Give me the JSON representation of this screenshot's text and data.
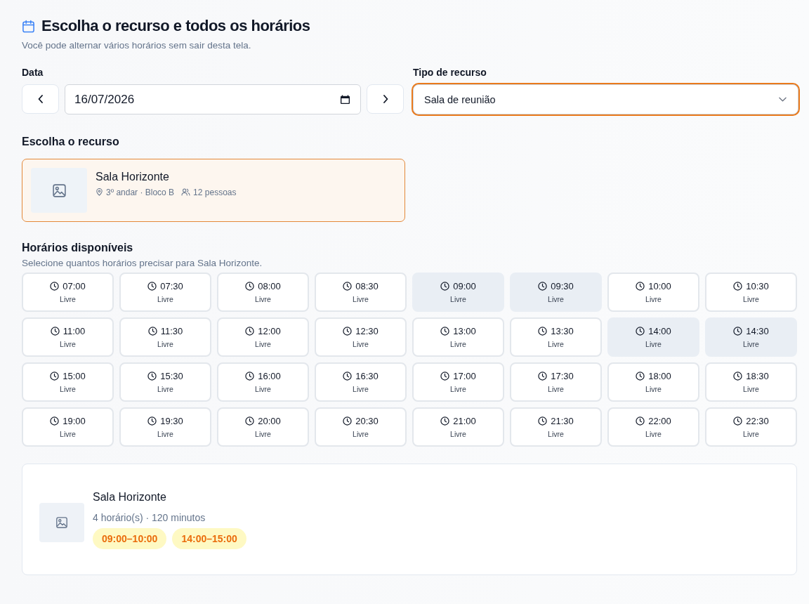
{
  "header": {
    "title": "Escolha o recurso e todos os horários",
    "subtitle": "Você pode alternar vários horários sem sair desta tela."
  },
  "date": {
    "label": "Data",
    "value": "16/07/2026"
  },
  "resource_type": {
    "label": "Tipo de recurso",
    "value": "Sala de reunião",
    "focused": true
  },
  "resources": {
    "title": "Escolha o recurso",
    "items": [
      {
        "name": "Sala Horizonte",
        "location": "3º andar · Bloco B",
        "capacity": "12 pessoas",
        "selected": true
      }
    ]
  },
  "slots": {
    "title": "Horários disponíveis",
    "subtitle": "Selecione quantos horários precisar para Sala Horizonte.",
    "items": [
      {
        "time": "07:00",
        "status": "Livre",
        "selected": false
      },
      {
        "time": "07:30",
        "status": "Livre",
        "selected": false
      },
      {
        "time": "08:00",
        "status": "Livre",
        "selected": false
      },
      {
        "time": "08:30",
        "status": "Livre",
        "selected": false
      },
      {
        "time": "09:00",
        "status": "Livre",
        "selected": true
      },
      {
        "time": "09:30",
        "status": "Livre",
        "selected": true
      },
      {
        "time": "10:00",
        "status": "Livre",
        "selected": false
      },
      {
        "time": "10:30",
        "status": "Livre",
        "selected": false
      },
      {
        "time": "11:00",
        "status": "Livre",
        "selected": false
      },
      {
        "time": "11:30",
        "status": "Livre",
        "selected": false
      },
      {
        "time": "12:00",
        "status": "Livre",
        "selected": false
      },
      {
        "time": "12:30",
        "status": "Livre",
        "selected": false
      },
      {
        "time": "13:00",
        "status": "Livre",
        "selected": false
      },
      {
        "time": "13:30",
        "status": "Livre",
        "selected": false
      },
      {
        "time": "14:00",
        "status": "Livre",
        "selected": true
      },
      {
        "time": "14:30",
        "status": "Livre",
        "selected": true
      },
      {
        "time": "15:00",
        "status": "Livre",
        "selected": false
      },
      {
        "time": "15:30",
        "status": "Livre",
        "selected": false
      },
      {
        "time": "16:00",
        "status": "Livre",
        "selected": false
      },
      {
        "time": "16:30",
        "status": "Livre",
        "selected": false
      },
      {
        "time": "17:00",
        "status": "Livre",
        "selected": false
      },
      {
        "time": "17:30",
        "status": "Livre",
        "selected": false
      },
      {
        "time": "18:00",
        "status": "Livre",
        "selected": false
      },
      {
        "time": "18:30",
        "status": "Livre",
        "selected": false
      },
      {
        "time": "19:00",
        "status": "Livre",
        "selected": false
      },
      {
        "time": "19:30",
        "status": "Livre",
        "selected": false
      },
      {
        "time": "20:00",
        "status": "Livre",
        "selected": false
      },
      {
        "time": "20:30",
        "status": "Livre",
        "selected": false
      },
      {
        "time": "21:00",
        "status": "Livre",
        "selected": false
      },
      {
        "time": "21:30",
        "status": "Livre",
        "selected": false
      },
      {
        "time": "22:00",
        "status": "Livre",
        "selected": false
      },
      {
        "time": "22:30",
        "status": "Livre",
        "selected": false
      }
    ]
  },
  "summary": {
    "name": "Sala Horizonte",
    "details": "4 horário(s) · 120 minutos",
    "ranges": [
      "09:00–10:00",
      "14:00–15:00"
    ]
  }
}
